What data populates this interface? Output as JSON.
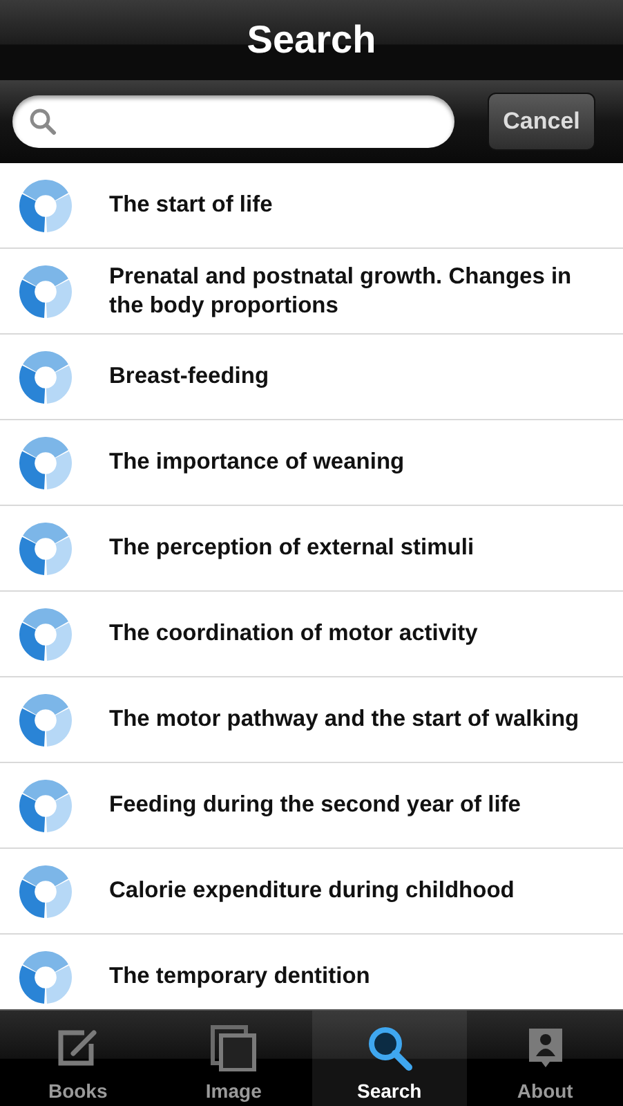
{
  "nav_bar": {
    "title": "Search"
  },
  "search": {
    "button": "Cancel"
  },
  "results": [
    {
      "title": "The start of life"
    },
    {
      "title": "Prenatal and postnatal growth. Changes in the body proportions"
    },
    {
      "title": "Breast-feeding"
    },
    {
      "title": "The importance of weaning"
    },
    {
      "title": "The perception of external stimuli"
    },
    {
      "title": "The coordination of motor activity"
    },
    {
      "title": "The motor pathway and the start of walking"
    },
    {
      "title": "Feeding during the second year of life"
    },
    {
      "title": "Calorie expenditure during childhood"
    },
    {
      "title": "The temporary dentition"
    }
  ],
  "tab_bar": [
    {
      "label": "Books",
      "kind": "books",
      "selected": false
    },
    {
      "label": "Image",
      "kind": "image",
      "selected": false
    },
    {
      "label": "Search",
      "kind": "search",
      "selected": true
    },
    {
      "label": "About",
      "kind": "about",
      "selected": false
    }
  ]
}
